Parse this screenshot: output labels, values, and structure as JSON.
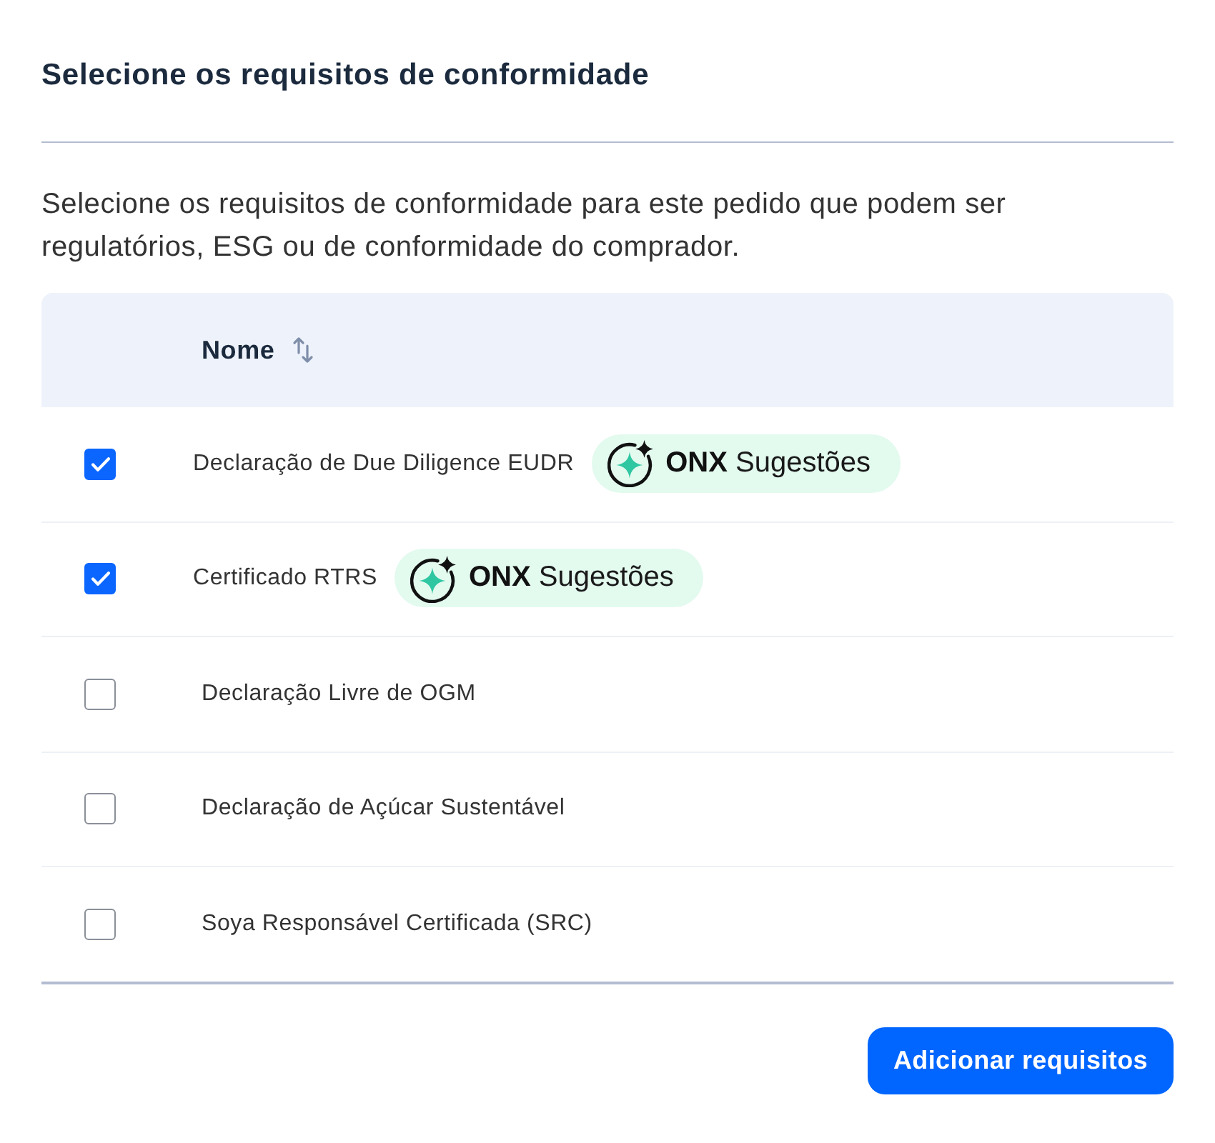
{
  "title": "Selecione os requisitos de conformidade",
  "description": "Selecione os requisitos de conformidade para este pedido que podem ser regulatórios, ESG ou de conformidade do comprador.",
  "table": {
    "columns": [
      {
        "label": "Nome"
      }
    ],
    "rows": [
      {
        "checked": true,
        "name": "Declaração de Due Diligence EUDR",
        "suggestion": {
          "label": "**ONX** Sugestões"
        }
      },
      {
        "checked": true,
        "name": "Certificado RTRS",
        "suggestion": {
          "label": "**ONX** Sugestões"
        }
      },
      {
        "checked": false,
        "name": "Declaração Livre de OGM"
      },
      {
        "checked": false,
        "name": "Declaração de Açúcar Sustentável"
      },
      {
        "checked": false,
        "name": "Soya Responsável Certificada (SRC)"
      }
    ]
  },
  "buttons": [
    {
      "label": "Adicionar requisitos"
    }
  ]
}
